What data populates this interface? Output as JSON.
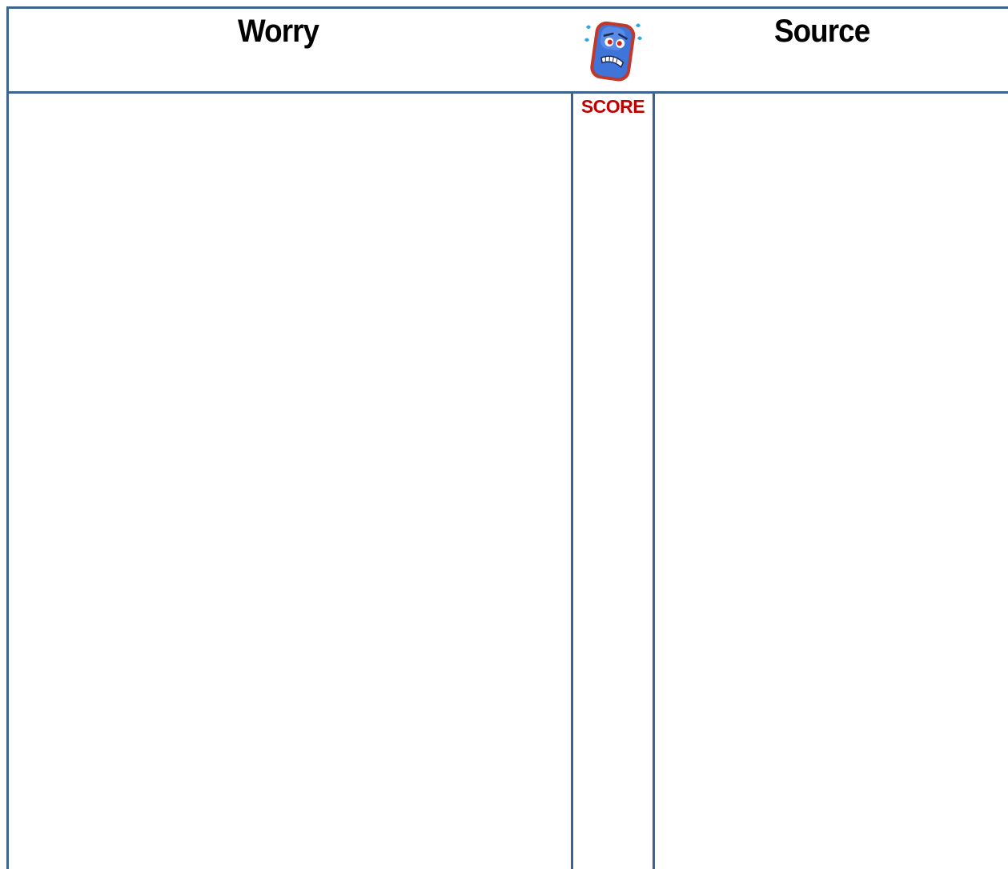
{
  "table": {
    "headers": {
      "worry": "Worry",
      "source": "Source",
      "score": "SCORE"
    },
    "icon": "worried-face-icon",
    "rows": []
  },
  "colors": {
    "border": "#3d6491",
    "score_text": "#c00000"
  }
}
